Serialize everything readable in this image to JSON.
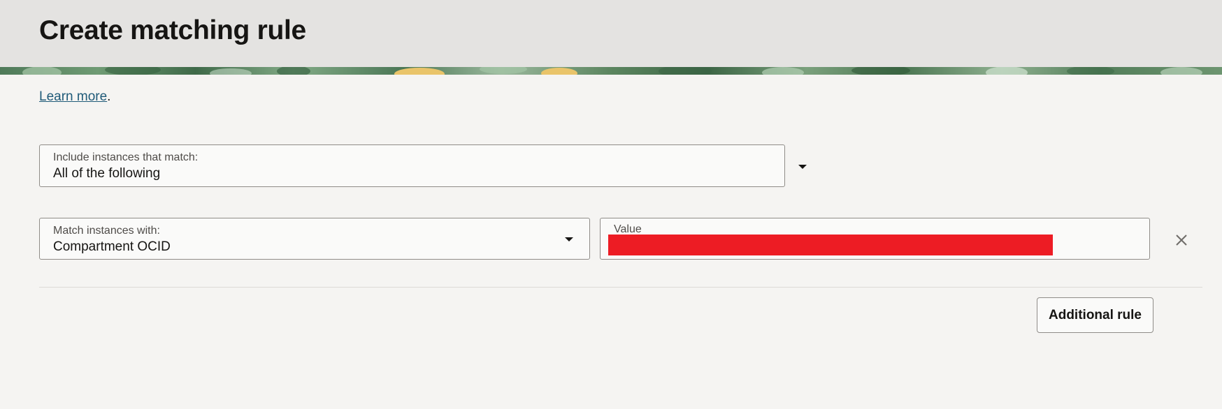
{
  "page": {
    "title": "Create matching rule"
  },
  "intro": {
    "learn_more": "Learn more",
    "trailing_punct": "."
  },
  "match_mode": {
    "label": "Include instances that match:",
    "value": "All of the following"
  },
  "rule": {
    "attribute_label": "Match instances with:",
    "attribute_value": "Compartment OCID",
    "value_label": "Value",
    "value_redacted": true
  },
  "actions": {
    "additional_rule": "Additional rule"
  },
  "colors": {
    "link": "#1f5a78",
    "redaction": "#ed1c24",
    "header_bg": "#e4e3e1",
    "page_bg": "#f5f4f2"
  },
  "icons": {
    "dropdown": "caret-down-icon",
    "remove": "close-icon"
  }
}
